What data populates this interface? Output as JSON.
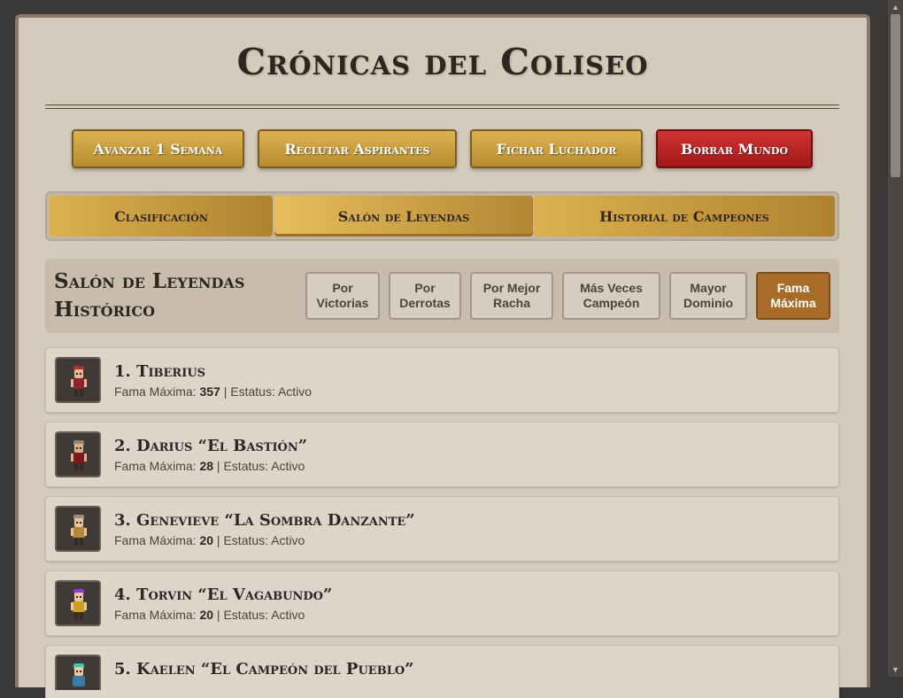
{
  "header": {
    "title": "Crónicas del Coliseo"
  },
  "actions": {
    "advance": "Avanzar 1 Semana",
    "recruit": "Reclutar Aspirantes",
    "sign": "Fichar Luchador",
    "reset": "Borrar Mundo"
  },
  "tabs": [
    "Clasificación",
    "Salón de Leyendas",
    "Historial de Campeones"
  ],
  "hall": {
    "title": "Salón de Leyendas Histórico",
    "sorts": [
      "Por Victorias",
      "Por Derrotas",
      "Por Mejor Racha",
      "Más Veces Campeón",
      "Mayor Dominio",
      "Fama Máxima"
    ],
    "active_sort": "Fama Máxima",
    "fame_label": "Fama Máxima:",
    "status_label": "Estatus:"
  },
  "fighters": [
    {
      "name": "1. Tiberius",
      "fame": "357",
      "status": "Activo",
      "hair": "#b2302a",
      "armor": "#8e2430",
      "skin": "#e8b894"
    },
    {
      "name": "2. Darius “El Bastión”",
      "fame": "28",
      "status": "Activo",
      "hair": "#8f8a68",
      "armor": "#7a1a1a",
      "skin": "#e2b08c"
    },
    {
      "name": "3. Genevieve “La Sombra Danzante”",
      "fame": "20",
      "status": "Activo",
      "hair": "#9a8e78",
      "armor": "#b08a3a",
      "skin": "#ebc09a"
    },
    {
      "name": "4. Torvin “El Vagabundo”",
      "fame": "20",
      "status": "Activo",
      "hair": "#8c3cc8",
      "armor": "#c9a020",
      "skin": "#f0c8a0"
    },
    {
      "name": "5. Kaelen “El Campeón del Pueblo”",
      "fame": "",
      "status": "",
      "hair": "#3ec8b4",
      "armor": "#3a7aa8",
      "skin": "#f0c8a0"
    }
  ],
  "colors": {
    "gold": "#c99b3f",
    "red": "#b82020",
    "active_sort": "#a86c28",
    "panel": "#d5cbbd"
  },
  "icons": [
    "fighter-sprite-icon"
  ]
}
